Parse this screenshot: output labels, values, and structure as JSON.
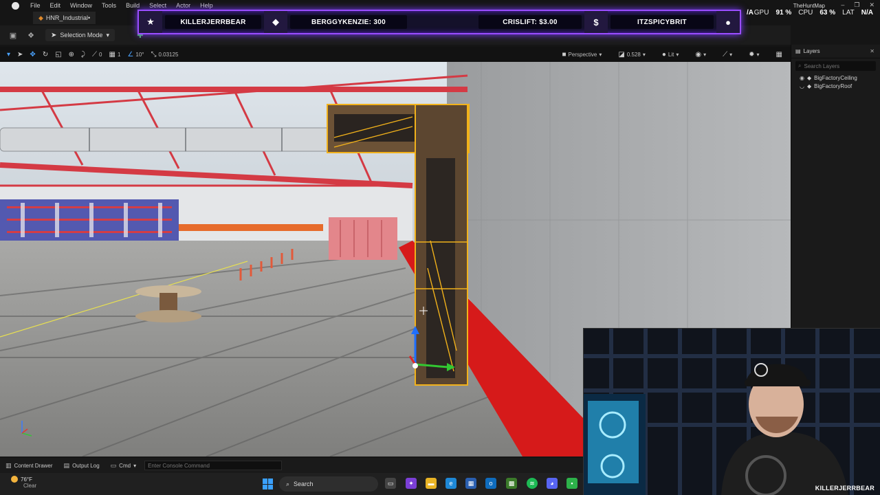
{
  "menubar": {
    "items": [
      "File",
      "Edit",
      "Window",
      "Tools",
      "Build",
      "Select",
      "Actor",
      "Help"
    ],
    "project_tab": "HNR_Industrial•",
    "window_controls": [
      "–",
      "❐",
      "✕"
    ]
  },
  "toolbar": {
    "mode_label": "Selection Mode",
    "icons": [
      "save-icon",
      "content-icon",
      "mode-icon"
    ]
  },
  "stream_overlay": {
    "segments": [
      {
        "icon": "★",
        "text": "KILLERJERRBEAR"
      },
      {
        "icon": "◆",
        "text": "BERGGYKENZIE: 300"
      },
      {
        "icon": "",
        "text": "CRISLIFT: $3.00"
      },
      {
        "icon": "$",
        "text": "ITZSPICYBRIT"
      },
      {
        "icon": "👤",
        "text": ""
      }
    ]
  },
  "stats": {
    "map_name": "TheHuntMap",
    "left_na": "/A",
    "gpu_label": "GPU",
    "gpu_value": "91 %",
    "cpu_label": "CPU",
    "cpu_value": "63 %",
    "lat_label": "LAT",
    "lat_value": "N/A"
  },
  "viewport_toolbar": {
    "snap_rotation": "10°",
    "snap_scale": "0.03125",
    "num_a": "0",
    "num_b": "1",
    "view_mode": "Perspective",
    "fov": "0.528",
    "lighting": "Lit"
  },
  "layers": {
    "title": "Layers",
    "search_placeholder": "Search Layers",
    "items": [
      "BigFactoryCeiling",
      "BigFactoryRoof"
    ]
  },
  "bottombar": {
    "content_drawer": "Content Drawer",
    "output_log": "Output Log",
    "cmd": "Cmd",
    "console_placeholder": "Enter Console Command"
  },
  "taskbar": {
    "weather_temp": "76°F",
    "weather_cond": "Clear",
    "search_label": "Search"
  },
  "webcam": {
    "label": "KILLERJERRBEAR"
  }
}
